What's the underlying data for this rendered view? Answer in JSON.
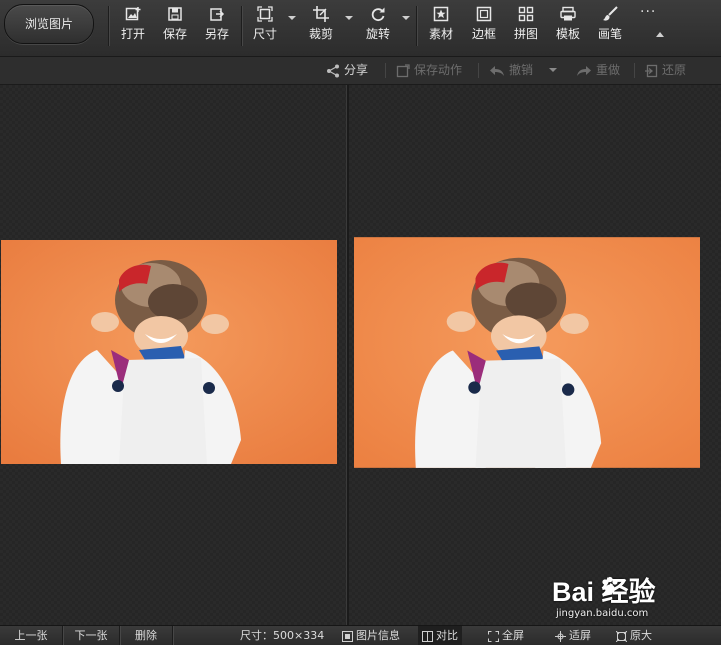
{
  "toolbar": {
    "browse_button": "浏览图片",
    "tools": [
      {
        "icon": "open-image-icon",
        "label": "打开"
      },
      {
        "icon": "save-icon",
        "label": "保存"
      },
      {
        "icon": "save-as-icon",
        "label": "另存"
      },
      {
        "icon": "resize-icon",
        "label": "尺寸"
      },
      {
        "icon": "crop-icon",
        "label": "裁剪"
      },
      {
        "icon": "rotate-icon",
        "label": "旋转"
      },
      {
        "icon": "material-icon",
        "label": "素材"
      },
      {
        "icon": "frame-icon",
        "label": "边框"
      },
      {
        "icon": "collage-icon",
        "label": "拼图"
      },
      {
        "icon": "template-icon",
        "label": "模板"
      },
      {
        "icon": "brush-icon",
        "label": "画笔"
      }
    ],
    "more": "···"
  },
  "actions": {
    "share": "分享",
    "save_action": "保存动作",
    "undo": "撤销",
    "redo": "重做",
    "restore": "还原"
  },
  "status": {
    "prev": "上一张",
    "next": "下一张",
    "delete": "删除",
    "size_label": "尺寸：",
    "size_value": "500×334",
    "info": "图片信息",
    "compare": "对比",
    "fullscreen": "全屏",
    "fit": "适屏",
    "original": "原大"
  },
  "watermark": {
    "brand": "Bai 经验",
    "url": "jingyan.baidu.com"
  },
  "colors": {
    "background": "#262626",
    "photo_background": "#f08a4b",
    "accent_disabled": "#6d6d6d"
  }
}
